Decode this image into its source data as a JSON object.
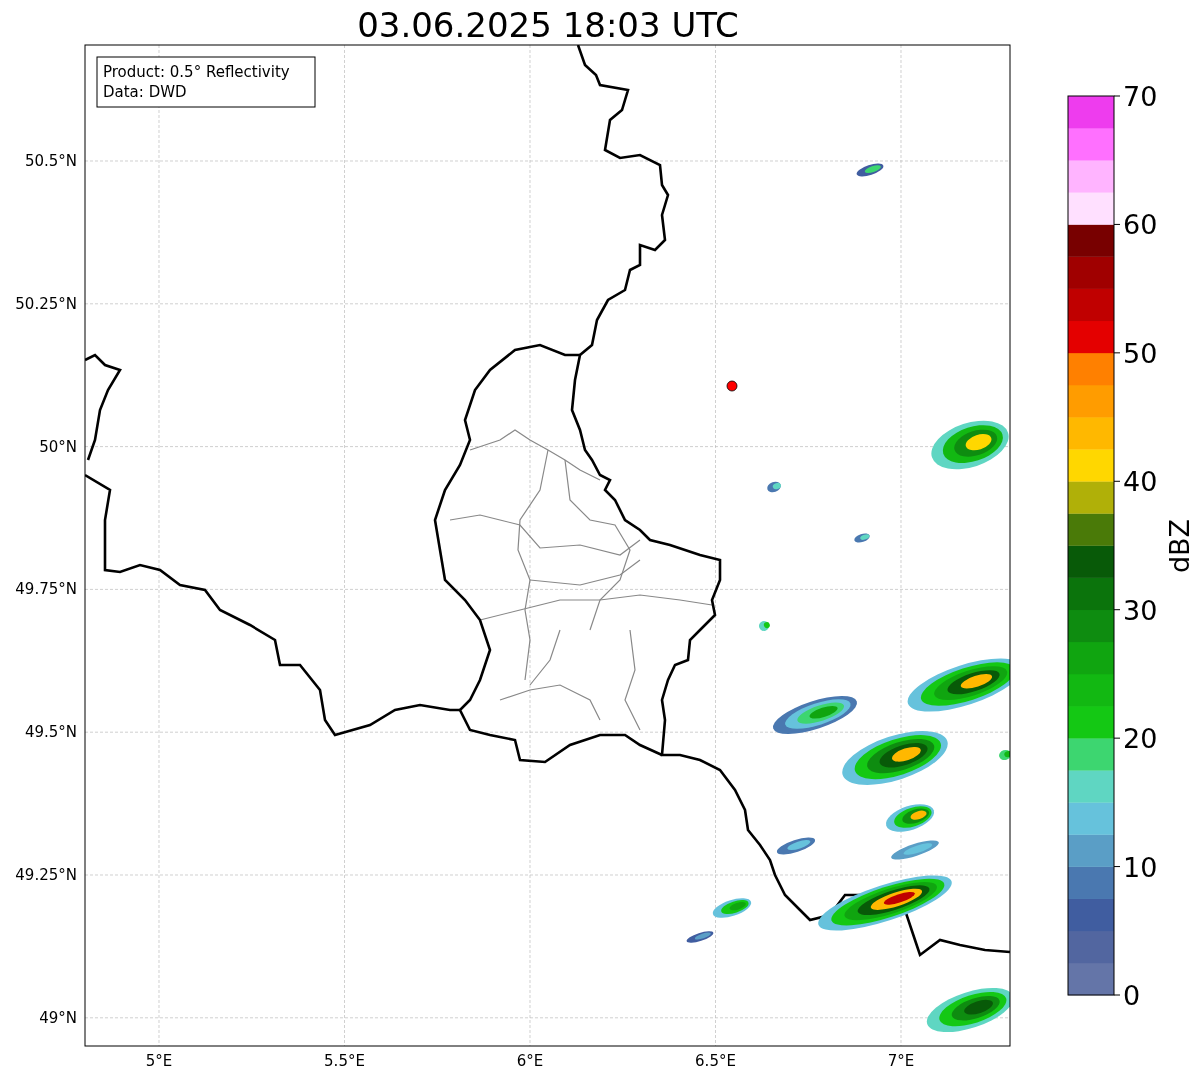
{
  "title": "03.06.2025 18:03 UTC",
  "info_box": {
    "lines": [
      "Product: 0.5° Reflectivity",
      "Data: DWD"
    ]
  },
  "map": {
    "xticks": [
      "5°E",
      "5.5°E",
      "6°E",
      "6.5°E",
      "7°E"
    ],
    "yticks": [
      "50.5°N",
      "50.25°N",
      "50°N",
      "49.75°N",
      "49.5°N",
      "49.25°N",
      "49°N"
    ],
    "site_marker": {
      "color": "#ff0000"
    }
  },
  "colorbar": {
    "label": "dBZ",
    "ticks": [
      "70",
      "60",
      "50",
      "40",
      "30",
      "20",
      "10",
      "0"
    ],
    "bands": [
      {
        "color": "#6475a8"
      },
      {
        "color": "#5266a0"
      },
      {
        "color": "#405da0"
      },
      {
        "color": "#4a78b0"
      },
      {
        "color": "#5a9ec6"
      },
      {
        "color": "#66c2dc"
      },
      {
        "color": "#5fd6c2"
      },
      {
        "color": "#3dd670"
      },
      {
        "color": "#14c814"
      },
      {
        "color": "#12b812"
      },
      {
        "color": "#10a510"
      },
      {
        "color": "#0e8c10"
      },
      {
        "color": "#0b740c"
      },
      {
        "color": "#085a08"
      },
      {
        "color": "#4a7a08"
      },
      {
        "color": "#b0b008"
      },
      {
        "color": "#ffd700"
      },
      {
        "color": "#ffb800"
      },
      {
        "color": "#ff9c00"
      },
      {
        "color": "#ff8000"
      },
      {
        "color": "#e40000"
      },
      {
        "color": "#c00000"
      },
      {
        "color": "#a00000"
      },
      {
        "color": "#780000"
      },
      {
        "color": "#ffe0ff"
      },
      {
        "color": "#ffb4ff"
      },
      {
        "color": "#ff70ff"
      },
      {
        "color": "#ee3cee"
      }
    ]
  }
}
